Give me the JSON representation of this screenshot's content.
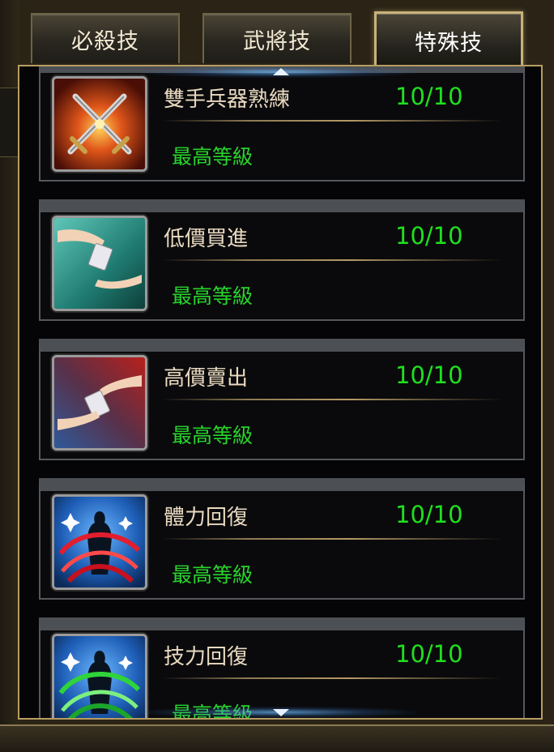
{
  "tabs": [
    {
      "label": "必殺技",
      "active": false
    },
    {
      "label": "武將技",
      "active": false
    },
    {
      "label": "特殊技",
      "active": true
    }
  ],
  "skills": [
    {
      "name": "雙手兵器熟練",
      "level": "10/10",
      "status": "最高等級",
      "icon": "crossed-swords-icon"
    },
    {
      "name": "低價買進",
      "level": "10/10",
      "status": "最高等級",
      "icon": "hands-exchange-icon"
    },
    {
      "name": "高價賣出",
      "level": "10/10",
      "status": "最高等級",
      "icon": "hands-exchange-icon"
    },
    {
      "name": "體力回復",
      "level": "10/10",
      "status": "最高等級",
      "icon": "hp-recovery-icon"
    },
    {
      "name": "技力回復",
      "level": "10/10",
      "status": "最高等級",
      "icon": "sp-recovery-icon"
    }
  ],
  "colors": {
    "level_green": "#1fe01f",
    "status_green": "#27d42b",
    "name_text": "#e9d9c0",
    "panel_border": "#b89d62"
  }
}
